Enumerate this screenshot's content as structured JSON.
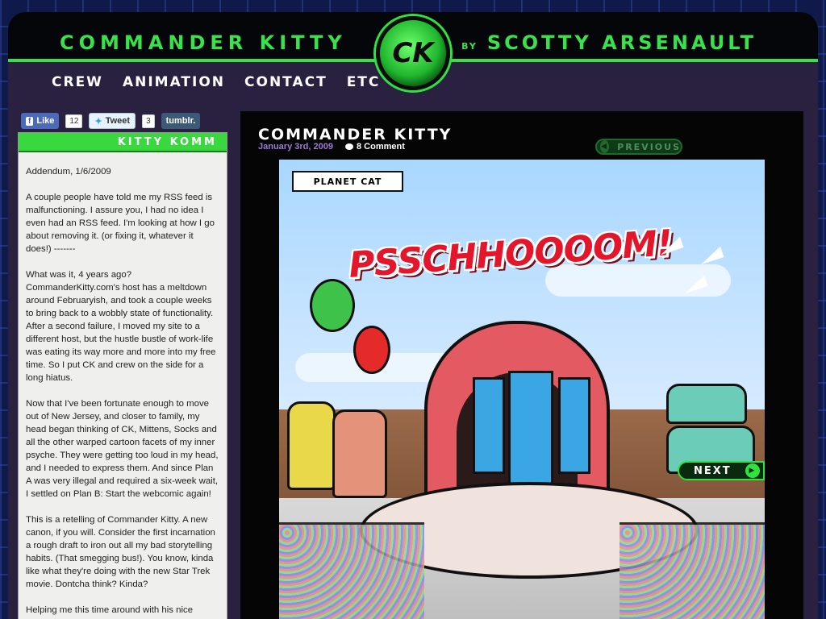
{
  "header": {
    "site_title": "COMMANDER KITTY",
    "by": "BY",
    "author": "SCOTTY ARSENAULT",
    "logo_text": "CK"
  },
  "nav": {
    "items": [
      "CREW",
      "ANIMATION",
      "CONTACT",
      "ETC"
    ]
  },
  "social": {
    "like_label": "Like",
    "like_count": "12",
    "tweet_label": "Tweet",
    "tweet_count": "3",
    "tumblr_label": "tumblr."
  },
  "sidebar": {
    "heading": "KITTY KOMM",
    "paragraphs": [
      "Addendum, 1/6/2009",
      "A couple people have told me my RSS feed is malfunctioning. I assure you, I had no idea I even had an RSS feed. I'm looking at how I go about removing it. (or fixing it, whatever it does!) -------",
      "What was it, 4 years ago? CommanderKitty.com's host has a meltdown around Februaryish, and took a couple weeks to bring back to a wobbly state of functionality. After a second failure, I moved my site to a different host, but the hustle bustle of work-life was eating its way more and more into my free time. So I put CK and crew on the side for a long hiatus.",
      "Now that I've been fortunate enough to move out of New Jersey, and closer to family, my head began thinking of CK, Mittens, Socks and all the other warped cartoon facets of my inner psyche. They were getting too loud in my head, and I needed to express them. And since Plan A was very illegal and required a six-week wait, I settled on Plan B: Start the webcomic again!",
      "This is a retelling of Commander Kitty. A new canon, if you will. Consider the first incarnation a rough draft to iron out all my bad storytelling habits. (That smegging bus!). You know, kinda like what they're doing with the new Star Trek movie. Dontcha think? Kinda?",
      "Helping me this time around with his nice coloring touch is Brian Reynolds. I'm thankful he's able to"
    ]
  },
  "post": {
    "title": "COMMANDER KITTY",
    "date": "January 3rd, 2009",
    "comments": "8 Comment",
    "previous_label": "PREVIOUS",
    "next_label": "NEXT"
  },
  "comic": {
    "caption": "PLANET CAT",
    "sfx": "PSSCHHOOOOM!"
  },
  "colors": {
    "accent_green": "#39e14b",
    "header_bg": "#05060a",
    "frame_bg": "#2a2140",
    "date_purple": "#9b7bd4"
  }
}
